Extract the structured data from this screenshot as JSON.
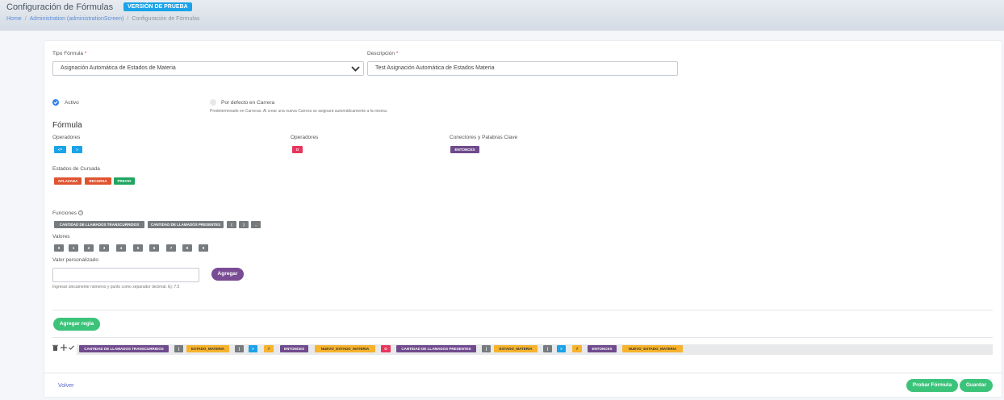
{
  "header": {
    "title": "Configuración de Fórmulas",
    "badge": "VERSIÓN DE PRUEBA",
    "breadcrumb": [
      "Home",
      "Administration (administrationScreen)",
      "Configuración de Fórmulas"
    ]
  },
  "form": {
    "tipo_label": "Tipo Fórmula",
    "tipo_value": "Asignación Automática de Estados de Materia",
    "desc_label": "Descripción",
    "desc_value": "Test Asignación Automática de Estados Materia",
    "required_mark": "*",
    "activo_label": "Activo",
    "defecto_label": "Por defecto en Carrera",
    "defecto_help": "Predeterminado en Carreras. Al crear una nueva Carrera se asignará automáticamente a la misma."
  },
  "formula": {
    "title": "Fórmula",
    "operadores1_label": "Operadores",
    "operadores1": [
      "<=",
      ">"
    ],
    "operadores2_label": "Operadores",
    "operadores2": [
      "O"
    ],
    "conectores_label": "Conectores y Palabras Clave",
    "conectores": [
      "ENTONCES"
    ],
    "estados_label": "Estados de Cursada",
    "estados": [
      "APLAZADA",
      "RECURSA",
      "PREVIO"
    ],
    "funciones_label": "Funciones",
    "funciones": [
      "CANTIDAD DE LLAMADOS TRANSCURRIDOS",
      "CANTIDAD DE LLAMADOS PRESENTES",
      "(",
      ")",
      ","
    ],
    "valores_label": "Valores",
    "valores": [
      "0",
      "1",
      "2",
      "3",
      "4",
      "5",
      "6",
      "7",
      "8",
      "9"
    ],
    "custom_label": "Valor personalizado",
    "custom_value": "",
    "custom_help": "Ingresar únicamente números y punto como separador decimal. Ej: 7.5",
    "agregar": "Agregar",
    "agregar_regla": "Agregar regla"
  },
  "rule": {
    "tokens": [
      {
        "t": "CANTIDAD DE LLAMADOS TRANSCURRIDOS",
        "c": "purple"
      },
      {
        "t": "(",
        "c": "grey"
      },
      {
        "t": "ESTADO_MATERIA",
        "c": "yellow"
      },
      {
        "t": ")",
        "c": "grey"
      },
      {
        "t": ">",
        "c": "blue"
      },
      {
        "t": "7",
        "c": "yellow"
      },
      {
        "t": "ENTONCES",
        "c": "purple"
      },
      {
        "t": "NUEVO_ESTADO_MATERIA",
        "c": "yellow"
      },
      {
        "t": "O",
        "c": "red"
      },
      {
        "t": "CANTIDAD DE LLAMADOS PRESENTES",
        "c": "purple"
      },
      {
        "t": "(",
        "c": "grey"
      },
      {
        "t": "ESTADO_MATERIA",
        "c": "yellow"
      },
      {
        "t": ")",
        "c": "grey"
      },
      {
        "t": ">",
        "c": "blue"
      },
      {
        "t": "7",
        "c": "yellow"
      },
      {
        "t": "ENTONCES",
        "c": "purple"
      },
      {
        "t": "NUEVO_ESTADO_MATERIA",
        "c": "yellow"
      }
    ]
  },
  "footer": {
    "volver": "Volver",
    "probar": "Probar Fórmula",
    "guardar": "Guardar"
  },
  "colors": {
    "accent_blue": "#1aa3e8",
    "green": "#3cc37a",
    "purple": "#6f4a8c",
    "yellow": "#f7b32b",
    "red": "#e8365d"
  }
}
